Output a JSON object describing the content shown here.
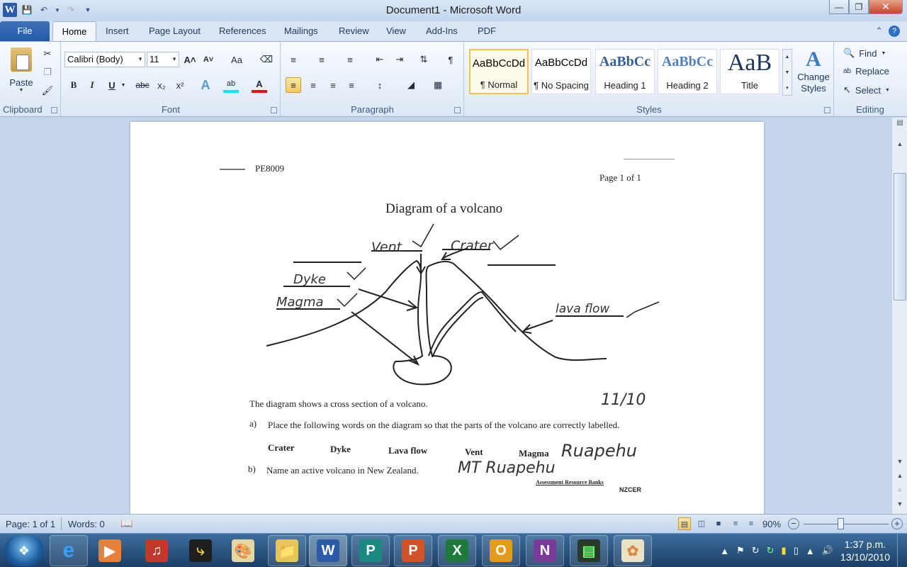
{
  "window": {
    "title": "Document1  -  Microsoft Word"
  },
  "tabs": [
    "File",
    "Home",
    "Insert",
    "Page Layout",
    "References",
    "Mailings",
    "Review",
    "View",
    "Add-Ins",
    "PDF"
  ],
  "active_tab": "Home",
  "ribbon": {
    "clipboard": {
      "label": "Clipboard",
      "paste": "Paste"
    },
    "font": {
      "label": "Font",
      "family": "Calibri (Body)",
      "size": "11",
      "bold": "B",
      "italic": "I",
      "underline": "U",
      "strike": "abc",
      "sub": "x₂",
      "sup": "x²",
      "grow": "A˄",
      "shrink": "A˅",
      "case": "Aa"
    },
    "paragraph": {
      "label": "Paragraph"
    },
    "styles": {
      "label": "Styles",
      "items": [
        {
          "preview": "AaBbCcDd",
          "name": "¶ Normal"
        },
        {
          "preview": "AaBbCcDd",
          "name": "¶ No Spacing"
        },
        {
          "preview": "AaBbCc",
          "name": "Heading 1"
        },
        {
          "preview": "AaBbCc",
          "name": "Heading 2"
        },
        {
          "preview": "AaB",
          "name": "Title"
        }
      ],
      "change": "Change Styles"
    },
    "editing": {
      "label": "Editing",
      "find": "Find",
      "replace": "Replace",
      "select": "Select"
    }
  },
  "document": {
    "code": "PE8009",
    "page_label": "Page 1 of 1",
    "heading": "Diagram of a volcano",
    "handwritten_labels": [
      "Vent",
      "Crater",
      "Dyke",
      "Magma",
      "lava flow"
    ],
    "intro": "The diagram shows a cross section of a volcano.",
    "q_a_marker": "a)",
    "q_a": "Place the following words on the diagram so that the parts of the volcano are correctly labelled.",
    "words": [
      "Crater",
      "Dyke",
      "Lava flow",
      "Vent",
      "Magma"
    ],
    "q_b_marker": "b)",
    "q_b": "Name an active volcano in New Zealand.",
    "answer": "MT Ruapehu",
    "answer_extra": "Ruapehu",
    "score": "11/10",
    "footer": "Assessment Resource Banks",
    "footer_logo": "NZCER"
  },
  "status": {
    "page": "Page: 1 of 1",
    "words": "Words: 0",
    "zoom": "90%"
  },
  "taskbar": {
    "apps": [
      "Internet Explorer",
      "Media Player",
      "Audio",
      "Fast Stone",
      "Paint",
      "Explorer",
      "Word",
      "Publisher",
      "PowerPoint",
      "Excel",
      "Outlook",
      "OneNote",
      "Task Manager",
      "Photo"
    ],
    "time": "1:37 p.m.",
    "date": "13/10/2010"
  }
}
